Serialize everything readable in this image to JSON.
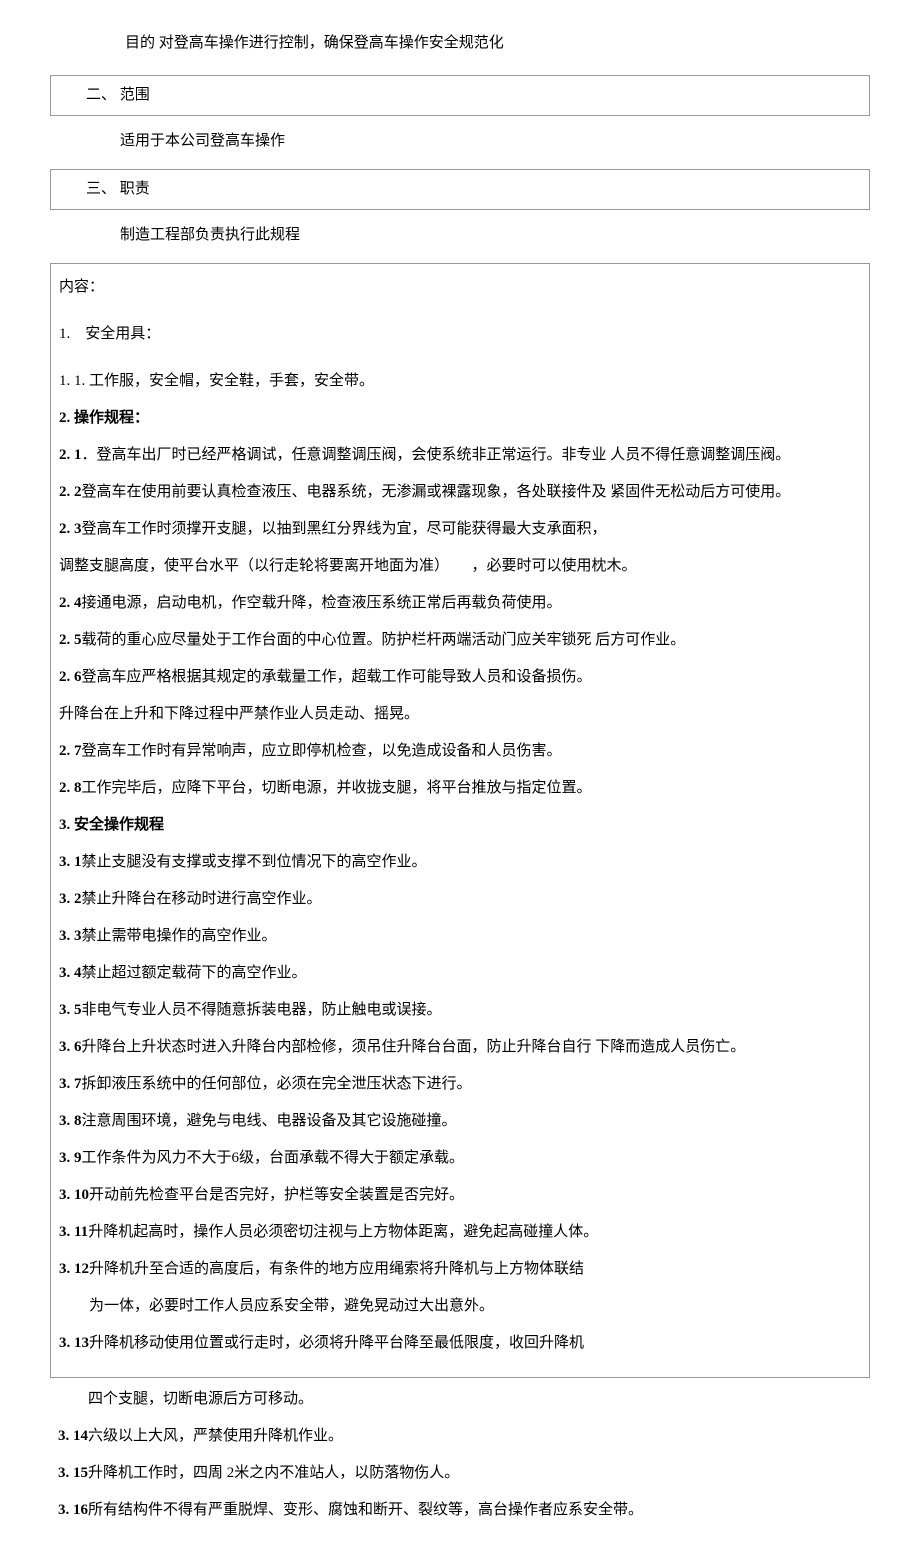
{
  "intro": "目的 对登高车操作进行控制，确保登高车操作安全规范化",
  "section2": {
    "header": "二、 范围",
    "content": "适用于本公司登高车操作"
  },
  "section3": {
    "header": "三、 职责",
    "content": "制造工程部负责执行此规程"
  },
  "contentBox": {
    "title": "内容：",
    "s1_title": "1.　安全用具：",
    "s1_1": "1. 1. 工作服，安全帽，安全鞋，手套，安全带。",
    "s2_title": "2. 操作规程：",
    "s2_1": "2. 1．登高车出厂时已经严格调试，任意调整调压阀，会使系统非正常运行。非专业 人员不得任意调整调压阀。",
    "s2_2": "2. 2登高车在使用前要认真检查液压、电器系统，无渗漏或裸露现象，各处联接件及 紧固件无松动后方可使用。",
    "s2_3": "2. 3登高车工作时须撑开支腿，以抽到黑红分界线为宜，尽可能获得最大支承面积，",
    "s2_3b": "调整支腿高度，使平台水平（以行走轮将要离开地面为准）　　，必要时可以使用枕木。",
    "s2_4": "2. 4接通电源，启动电机，作空载升降，检查液压系统正常后再载负荷使用。",
    "s2_5": "2. 5载荷的重心应尽量处于工作台面的中心位置。防护栏杆两端活动门应关牢锁死 后方可作业。",
    "s2_6": "2. 6登高车应严格根据其规定的承载量工作，超载工作可能导致人员和设备损伤。",
    "s2_6b": "升降台在上升和下降过程中严禁作业人员走动、摇晃。",
    "s2_7": "2. 7登高车工作时有异常响声，应立即停机检查，以免造成设备和人员伤害。",
    "s2_8": "2. 8工作完毕后，应降下平台，切断电源，并收拢支腿，将平台推放与指定位置。",
    "s3_title": "3. 安全操作规程",
    "s3_1": "3. 1禁止支腿没有支撑或支撑不到位情况下的高空作业。",
    "s3_2": "3. 2禁止升降台在移动时进行高空作业。",
    "s3_3": "3. 3禁止需带电操作的高空作业。",
    "s3_4": "3. 4禁止超过额定载荷下的高空作业。",
    "s3_5": "3. 5非电气专业人员不得随意拆装电器，防止触电或误接。",
    "s3_6": "3. 6升降台上升状态时进入升降台内部检修，须吊住升降台台面，防止升降台自行 下降而造成人员伤亡。",
    "s3_7": "3. 7拆卸液压系统中的任何部位，必须在完全泄压状态下进行。",
    "s3_8": "3. 8注意周围环境，避免与电线、电器设备及其它设施碰撞。",
    "s3_9": "3. 9工作条件为风力不大于6级，台面承载不得大于额定承载。",
    "s3_10": "3. 10开动前先检查平台是否完好，护栏等安全装置是否完好。",
    "s3_11": "3. 11升降机起高时，操作人员必须密切注视与上方物体距离，避免起高碰撞人体。",
    "s3_12": "3. 12升降机升至合适的高度后，有条件的地方应用绳索将升降机与上方物体联结",
    "s3_12b": "为一体，必要时工作人员应系安全带，避免晃动过大出意外。",
    "s3_13": "3. 13升降机移动使用位置或行走时，必须将升降平台降至最低限度，收回升降机"
  },
  "afterBox": {
    "s3_13b": "四个支腿，切断电源后方可移动。",
    "s3_14": "3. 14六级以上大风，严禁使用升降机作业。",
    "s3_15": "3. 15升降机工作时，四周 2米之内不准站人，以防落物伤人。",
    "s3_16": "3. 16所有结构件不得有严重脱焊、变形、腐蚀和断开、裂纹等，高台操作者应系安全带。"
  }
}
